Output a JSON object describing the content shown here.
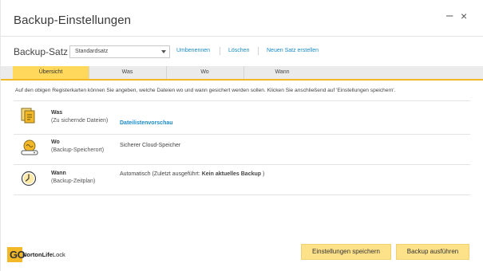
{
  "window": {
    "title": "Backup-Einstellungen",
    "minimize_glyph": "–",
    "close_glyph": "×"
  },
  "backup_set": {
    "label": "Backup-Satz",
    "selected": "Standardsatz",
    "links": [
      "Umbenennen",
      "Löschen",
      "Neuen Satz erstellen"
    ]
  },
  "tabs": [
    {
      "label": "Übersicht",
      "active": true
    },
    {
      "label": "Was",
      "active": false
    },
    {
      "label": "Wo",
      "active": false
    },
    {
      "label": "Wann",
      "active": false
    }
  ],
  "intro_text": "Auf den obigen Registerkarten können Sie angeben, welche Dateien wo und wann gesichert werden sollen. Klicken Sie anschließend auf 'Einstellungen speichern'.",
  "rows": {
    "what": {
      "title": "Was",
      "subtitle": "(Zu sichernde Dateien)",
      "link": "Dateilistenvorschau",
      "icon": "files-folder-icon"
    },
    "where": {
      "title": "Wo",
      "subtitle": "(Backup-Speicherort)",
      "value": "Sicherer Cloud-Speicher",
      "icon": "cloud-drive-icon"
    },
    "when": {
      "title": "Wann",
      "subtitle": "(Backup-Zeitplan)",
      "value_prefix": "Automatisch  (Zuletzt ausgeführt: ",
      "value_bold": "Kein aktuelles Backup",
      "value_suffix": " )",
      "icon": "clock-icon"
    }
  },
  "footer": {
    "logo_badge": "GO",
    "logo_bold": "NortonLife",
    "logo_rest": "Lock",
    "save_button": "Einstellungen speichern",
    "run_button": "Backup ausführen"
  },
  "colors": {
    "accent_yellow": "#f2b827",
    "active_tab": "#ffd85c",
    "button_bg": "#fde28a",
    "link_blue": "#1a8bc7"
  }
}
